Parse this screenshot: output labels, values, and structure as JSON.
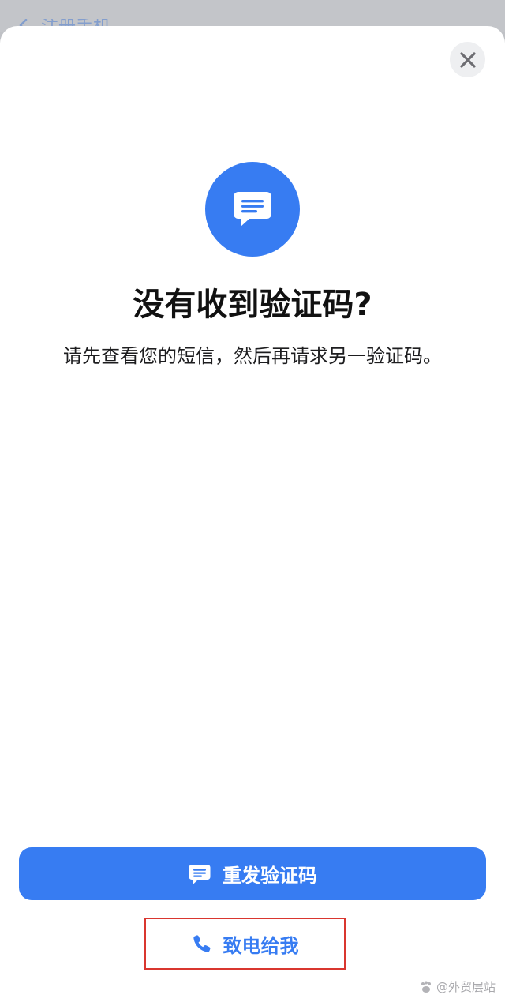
{
  "backdrop": {
    "back_label": "注册手机"
  },
  "sheet": {
    "close_icon": "close-x-icon",
    "hero_icon": "message-bubble-icon",
    "title": "没有收到验证码?",
    "subtitle": "请先查看您的短信，然后再请求另一验证码。"
  },
  "actions": {
    "resend_label": "重发验证码",
    "resend_icon": "message-bubble-icon",
    "call_label": "致电给我",
    "call_icon": "phone-icon"
  },
  "watermark": {
    "text": "@外贸层站"
  },
  "colors": {
    "accent": "#377cf2",
    "highlight_border": "#d9362f",
    "backdrop": "#bfc1c5"
  }
}
